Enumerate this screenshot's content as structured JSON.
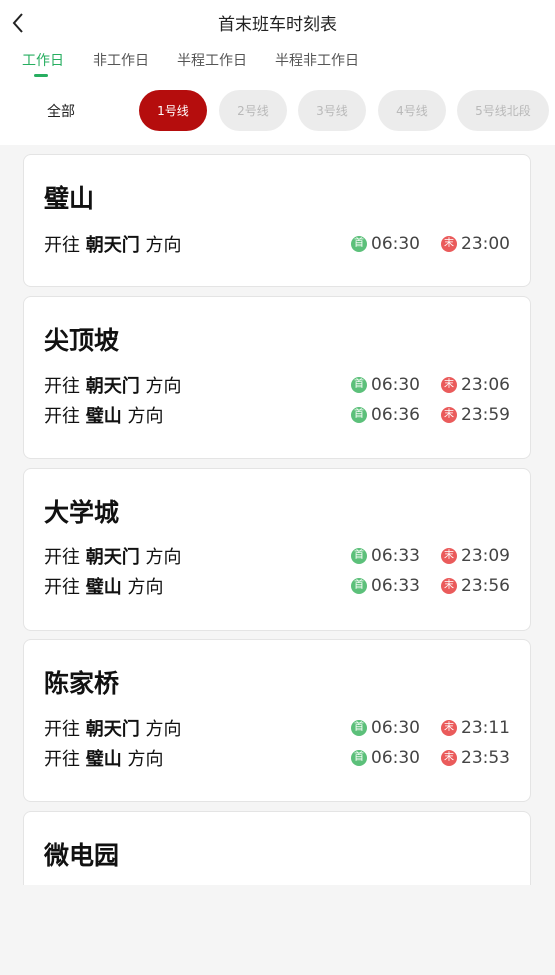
{
  "header": {
    "title": "首末班车时刻表",
    "back_icon": "chevron-left-icon"
  },
  "tabs": [
    {
      "label": "工作日",
      "active": true
    },
    {
      "label": "非工作日",
      "active": false
    },
    {
      "label": "半程工作日",
      "active": false
    },
    {
      "label": "半程非工作日",
      "active": false
    }
  ],
  "line_filter": {
    "all_label": "全部",
    "lines": [
      {
        "label": "1号线",
        "active": true
      },
      {
        "label": "2号线",
        "active": false
      },
      {
        "label": "3号线",
        "active": false
      },
      {
        "label": "4号线",
        "active": false
      },
      {
        "label": "5号线北段",
        "active": false
      }
    ]
  },
  "badges": {
    "first": "首",
    "last": "末"
  },
  "colors": {
    "accent_green": "#27ae60",
    "line_red": "#b50d0d",
    "first_badge": "#5cc07a",
    "last_badge": "#ea5b5b"
  },
  "stations": [
    {
      "name": "璧山",
      "directions": [
        {
          "prefix": "开往",
          "terminal": "朝天门",
          "suffix": "方向",
          "first": "06:30",
          "last": "23:00"
        }
      ]
    },
    {
      "name": "尖顶坡",
      "directions": [
        {
          "prefix": "开往",
          "terminal": "朝天门",
          "suffix": "方向",
          "first": "06:30",
          "last": "23:06"
        },
        {
          "prefix": "开往",
          "terminal": "璧山",
          "suffix": "方向",
          "first": "06:36",
          "last": "23:59"
        }
      ]
    },
    {
      "name": "大学城",
      "directions": [
        {
          "prefix": "开往",
          "terminal": "朝天门",
          "suffix": "方向",
          "first": "06:33",
          "last": "23:09"
        },
        {
          "prefix": "开往",
          "terminal": "璧山",
          "suffix": "方向",
          "first": "06:33",
          "last": "23:56"
        }
      ]
    },
    {
      "name": "陈家桥",
      "directions": [
        {
          "prefix": "开往",
          "terminal": "朝天门",
          "suffix": "方向",
          "first": "06:30",
          "last": "23:11"
        },
        {
          "prefix": "开往",
          "terminal": "璧山",
          "suffix": "方向",
          "first": "06:30",
          "last": "23:53"
        }
      ]
    },
    {
      "name": "微电园",
      "directions": []
    }
  ]
}
